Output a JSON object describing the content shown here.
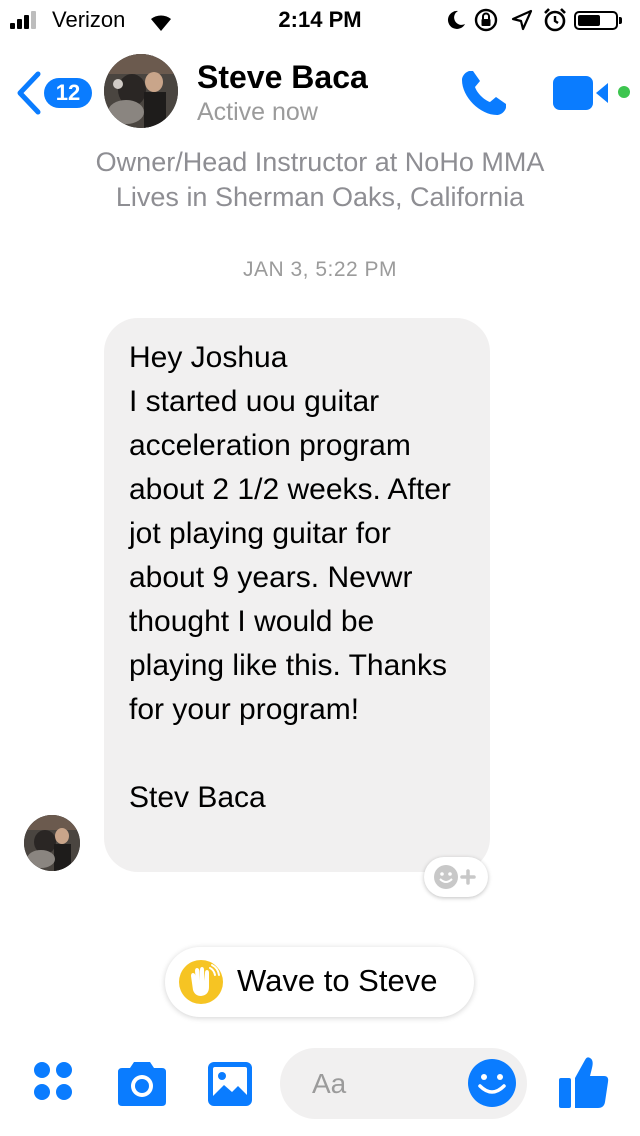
{
  "status_bar": {
    "carrier": "Verizon",
    "time": "2:14 PM",
    "icons": [
      "signal-bars-icon",
      "wifi-icon",
      "moon-icon",
      "rotation-lock-icon",
      "location-arrow-icon",
      "alarm-icon",
      "battery-icon"
    ]
  },
  "header": {
    "back_count": "12",
    "contact_name": "Steve Baca",
    "status": "Active now",
    "call_icon": "phone-icon",
    "video_icon": "video-camera-icon",
    "accent_color": "#0a7cff",
    "online_color": "#3dc54f"
  },
  "profile": {
    "line1": "Owner/Head Instructor at NoHo MMA",
    "line2": "Lives in Sherman Oaks, California"
  },
  "conversation": {
    "timestamp": "JAN 3, 5:22 PM",
    "message": "Hey Joshua\nI started uou guitar acceleration program about 2 1/2 weeks. After jot playing guitar for about 9 years. Nevwr thought I would be playing like this. Thanks for your program!\n\nStev Baca"
  },
  "wave": {
    "label": "Wave to Steve",
    "icon": "waving-hand-icon"
  },
  "composer": {
    "placeholder": "Aa",
    "icons": [
      "more-apps-icon",
      "camera-icon",
      "gallery-icon",
      "emoji-icon",
      "thumbs-up-icon"
    ]
  }
}
